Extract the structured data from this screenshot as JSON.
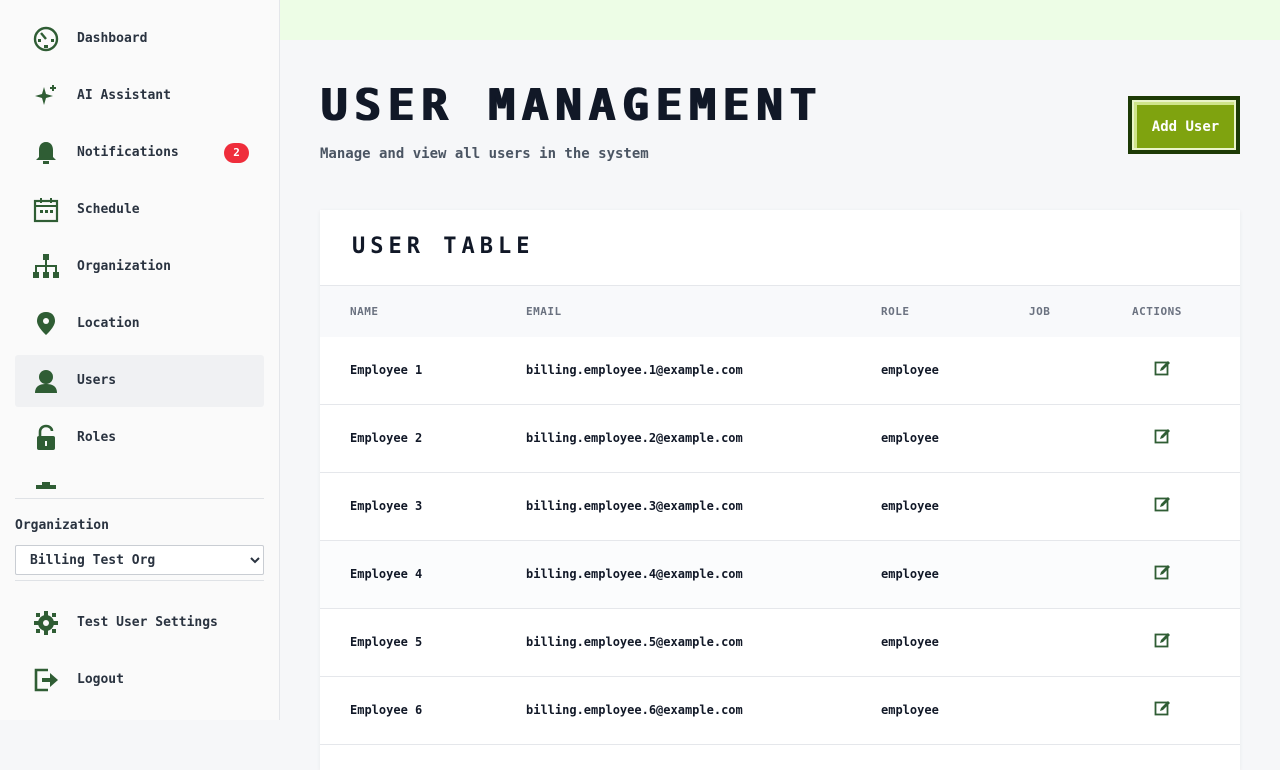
{
  "sidebar": {
    "nav": [
      {
        "label": "Dashboard",
        "icon": "dashboard-icon"
      },
      {
        "label": "AI Assistant",
        "icon": "sparkle-icon"
      },
      {
        "label": "Notifications",
        "icon": "bell-icon",
        "badge": "2"
      },
      {
        "label": "Schedule",
        "icon": "calendar-icon"
      },
      {
        "label": "Organization",
        "icon": "org-chart-icon"
      },
      {
        "label": "Location",
        "icon": "location-pin-icon"
      },
      {
        "label": "Users",
        "icon": "user-icon",
        "active": true
      },
      {
        "label": "Roles",
        "icon": "lock-icon"
      }
    ],
    "org_label": "Organization",
    "org_selected": "Billing Test Org",
    "bottom": [
      {
        "label": "Test User Settings",
        "icon": "gear-icon"
      },
      {
        "label": "Logout",
        "icon": "logout-icon"
      }
    ]
  },
  "header": {
    "title": "USER MANAGEMENT",
    "subtitle": "Manage and view all users in the system",
    "add_button": "Add User"
  },
  "table": {
    "title": "USER TABLE",
    "columns": [
      "NAME",
      "EMAIL",
      "ROLE",
      "JOB",
      "ACTIONS"
    ],
    "rows": [
      {
        "name": "Employee 1",
        "email": "billing.employee.1@example.com",
        "role": "employee",
        "job": ""
      },
      {
        "name": "Employee 2",
        "email": "billing.employee.2@example.com",
        "role": "employee",
        "job": ""
      },
      {
        "name": "Employee 3",
        "email": "billing.employee.3@example.com",
        "role": "employee",
        "job": ""
      },
      {
        "name": "Employee 4",
        "email": "billing.employee.4@example.com",
        "role": "employee",
        "job": ""
      },
      {
        "name": "Employee 5",
        "email": "billing.employee.5@example.com",
        "role": "employee",
        "job": ""
      },
      {
        "name": "Employee 6",
        "email": "billing.employee.6@example.com",
        "role": "employee",
        "job": ""
      }
    ]
  },
  "colors": {
    "accent": "#2f5d34",
    "button": "#7fa30f",
    "badge": "#ef2d3b",
    "topbar": "#edfde6"
  }
}
